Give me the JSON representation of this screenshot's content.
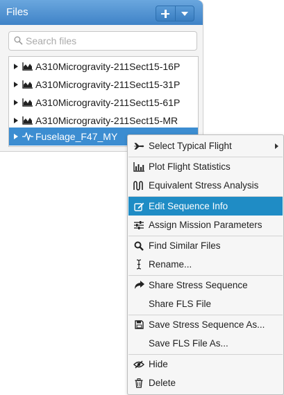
{
  "panel": {
    "title": "Files",
    "add_icon": "plus-icon",
    "dropdown_icon": "caret-down-icon"
  },
  "search": {
    "placeholder": "Search files",
    "value": "",
    "icon": "search-icon"
  },
  "files": [
    {
      "label": "A310Microgravity-211Sect15-16P",
      "icon": "chart-area-icon",
      "selected": false
    },
    {
      "label": "A310Microgravity-211Sect15-31P",
      "icon": "chart-area-icon",
      "selected": false
    },
    {
      "label": "A310Microgravity-211Sect15-61P",
      "icon": "chart-area-icon",
      "selected": false
    },
    {
      "label": "A310Microgravity-211Sect15-MR",
      "icon": "chart-area-icon",
      "selected": false
    },
    {
      "label": "Fuselage_F47_MY",
      "icon": "waveform-icon",
      "selected": true
    }
  ],
  "context_menu": {
    "items": [
      {
        "label": "Select Typical Flight",
        "icon": "airplane-icon",
        "submenu": true
      },
      {
        "label": "Plot Flight Statistics",
        "icon": "bar-chart-icon"
      },
      {
        "label": "Equivalent Stress Analysis",
        "icon": "sine-wave-icon"
      },
      {
        "label": "Edit Sequence Info",
        "icon": "edit-icon",
        "highlighted": true
      },
      {
        "label": "Assign Mission Parameters",
        "icon": "sliders-icon"
      },
      {
        "label": "Find Similar Files",
        "icon": "search-icon"
      },
      {
        "label": "Rename...",
        "icon": "text-cursor-icon"
      },
      {
        "label": "Share Stress Sequence",
        "icon": "share-icon"
      },
      {
        "label": "Share FLS File",
        "icon": ""
      },
      {
        "label": "Save Stress Sequence As...",
        "icon": "save-icon"
      },
      {
        "label": "Save FLS File As...",
        "icon": ""
      },
      {
        "label": "Hide",
        "icon": "eye-slash-icon"
      },
      {
        "label": "Delete",
        "icon": "trash-icon"
      }
    ]
  },
  "colors": {
    "header": "#4a8fd0",
    "selection": "#3c8dd1",
    "menu_highlight": "#1f8cc5"
  }
}
